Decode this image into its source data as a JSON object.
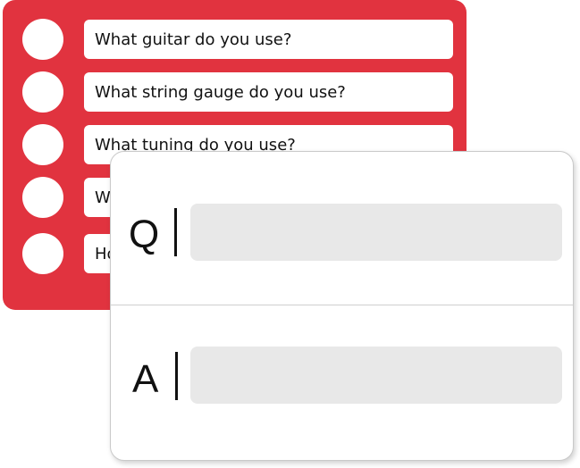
{
  "questions": [
    {
      "label": "What guitar do you use?"
    },
    {
      "label": "What string gauge do you use?"
    },
    {
      "label": "What tuning do you use?"
    },
    {
      "label": "W"
    },
    {
      "label": "Ho"
    }
  ],
  "qa": {
    "question_letter": "Q",
    "answer_letter": "A",
    "question_value": "",
    "answer_value": ""
  },
  "colors": {
    "list_background": "#e1333f",
    "field_background": "#e8e8e8"
  }
}
